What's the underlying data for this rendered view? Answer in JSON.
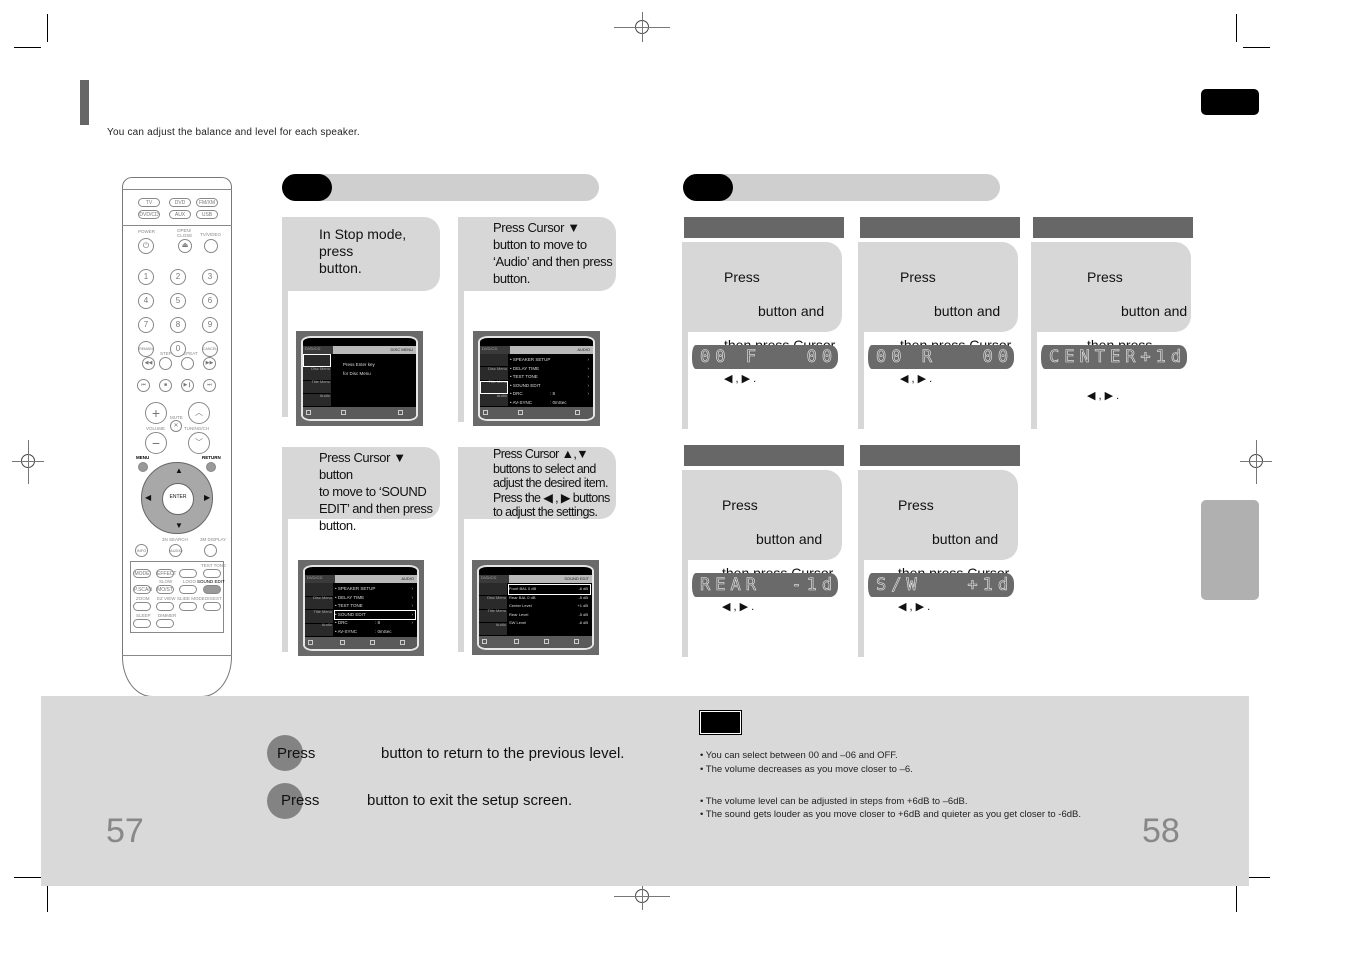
{
  "header": {
    "subtitle": "You can adjust the balance and level for each speaker."
  },
  "left_page": {
    "page_number": "57",
    "steps": [
      {
        "text": "In Stop mode,\npress\nbutton."
      },
      {
        "text": "Press Cursor ▼\nbutton to move to\n‘Audio’ and then press\n         button."
      },
      {
        "text": "Press Cursor ▼ button\nto move to ‘SOUND\nEDIT’ and then press\n          button."
      },
      {
        "text": "Press Cursor  ▲,▼\nbuttons to select and\nadjust the desired item.\nPress the  ◀ , ▶  buttons\nto adjust the settings."
      }
    ],
    "screens": [
      {
        "title_left": "DVD/CD",
        "title_right": "DISC MENU",
        "sidebar": [
          "Disc Menu",
          "Title Menu",
          "Audio",
          "Setup"
        ],
        "selected_sidebar": 0,
        "message": [
          "Press Enter key",
          "for Disc Menu"
        ]
      },
      {
        "title_left": "DVD/CD",
        "title_right": "AUDIO",
        "sidebar": [
          "Disc Menu",
          "Title Menu",
          "Audio",
          "Setup"
        ],
        "selected_sidebar": 2,
        "rows": [
          {
            "label": "• SPEAKER SETUP",
            "value": "",
            "arrow": "›"
          },
          {
            "label": "• DELAY TIME",
            "value": "",
            "arrow": "›"
          },
          {
            "label": "• TEST TONE",
            "value": "",
            "arrow": "›"
          },
          {
            "label": "• SOUND EDIT",
            "value": "",
            "arrow": "›"
          },
          {
            "label": "• DRC",
            "value": ": 8",
            "arrow": "›"
          },
          {
            "label": "• AV-SYNC",
            "value": ": 0mSec",
            "arrow": ""
          }
        ]
      },
      {
        "title_left": "DVD/CD",
        "title_right": "AUDIO",
        "sidebar": [
          "Disc Menu",
          "Title Menu",
          "Audio",
          "Setup"
        ],
        "selected_sidebar": -1,
        "highlight_row": 3,
        "rows": [
          {
            "label": "• SPEAKER SETUP",
            "value": "",
            "arrow": "›"
          },
          {
            "label": "• DELAY TIME",
            "value": "",
            "arrow": "›"
          },
          {
            "label": "• TEST TONE",
            "value": "",
            "arrow": "›"
          },
          {
            "label": "• SOUND EDIT",
            "value": "",
            "arrow": "›"
          },
          {
            "label": "• DRC",
            "value": ": 8",
            "arrow": "›"
          },
          {
            "label": "• AV-SYNC",
            "value": ": 0mSec",
            "arrow": ""
          }
        ]
      },
      {
        "title_left": "DVD/CD",
        "title_right": "SOUND EDIT",
        "sidebar": [
          "Disc Menu",
          "Title Menu",
          "Audio",
          "Setup"
        ],
        "selected_sidebar": -1,
        "highlight_row": 0,
        "rows": [
          {
            "label": "Front BAL  0 dB",
            "value": "",
            "arrow": "-6 dB"
          },
          {
            "label": "Rear BAL  0 dB",
            "value": "",
            "arrow": "-5 dB"
          },
          {
            "label": "Center Level",
            "value": "",
            "arrow": "+1 dB"
          },
          {
            "label": "Rear Level",
            "value": "",
            "arrow": "-5 dB"
          },
          {
            "label": "SW  Level",
            "value": "",
            "arrow": "-6 dB"
          }
        ]
      }
    ],
    "bottom": {
      "press_label": "Press",
      "line1": "button to return to the previous level.",
      "line2": "button to exit the setup screen."
    }
  },
  "right_page": {
    "page_number": "58",
    "step_text": {
      "line1": "Press",
      "line2": "button and",
      "line3": "then press Cursor",
      "line4": "◀ , ▶ ."
    },
    "displays": [
      "00 F   00",
      "00 R   00",
      "CENTER+1dB",
      "REAR  -1dB",
      "S/W   +1dB"
    ],
    "notes_group1": [
      "You can select between 00 and –06 and OFF.",
      "The volume decreases as you move closer to –6."
    ],
    "notes_group2": [
      "The volume level can be adjusted in steps from +6dB to –6dB.",
      "The sound gets louder as you move closer to +6dB and quieter as you get closer to -6dB."
    ]
  },
  "remote": {
    "source_buttons": [
      "TV",
      "DVD",
      "FM/XM",
      "DVD/CD",
      "AUX",
      "USB"
    ],
    "labels": {
      "power": "POWER",
      "open_close": "OPEN/ CLOSE",
      "tv_video": "TV/VIDEO",
      "step": "STEP",
      "repeat": "REPEAT",
      "mute": "MUTE",
      "volume": "VOLUME",
      "tuning": "TUNING/CH",
      "menu": "MENU",
      "return": "RETURN",
      "enter": "ENTER",
      "search": "3N SEARCH",
      "display": "3M DISPLAY",
      "info": "INFO",
      "audio": "AUDIO",
      "sound_edit": "SOUND EDIT",
      "test_tone": "TEST TONE",
      "slow": "SLOW",
      "logo": "LOGO",
      "zoom": "ZOOM",
      "ez_view": "EZ VIEW",
      "slide_mode": "SLIDE MODE",
      "digest": "DIGEST",
      "sleep": "SLEEP",
      "dimmer": "DIMMER",
      "mode": "MODE",
      "effect": "EFFECT",
      "pscan": "P.SCAN",
      "mo_st": "MO/ST",
      "remain": "REMAIN",
      "cancel": "CANCEL"
    },
    "digits": [
      "1",
      "2",
      "3",
      "4",
      "5",
      "6",
      "7",
      "8",
      "9",
      "0"
    ]
  }
}
